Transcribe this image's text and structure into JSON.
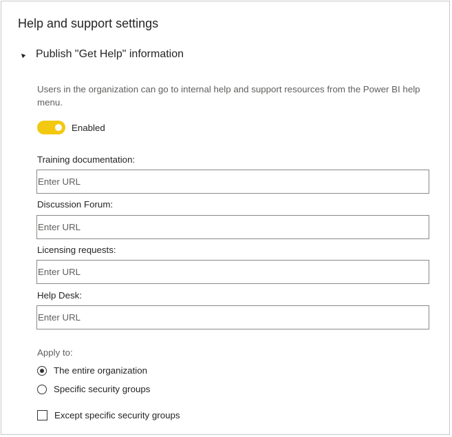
{
  "page": {
    "title": "Help and support settings"
  },
  "section": {
    "title": "Publish \"Get Help\" information",
    "icon": "caret-expanded-icon",
    "description": "Users in the organization can go to internal help and support resources from the Power BI help menu."
  },
  "toggle": {
    "label": "Enabled",
    "state": "on",
    "color": "#f2c811"
  },
  "fields": [
    {
      "label": "Training documentation:",
      "value": "",
      "placeholder": "Enter URL"
    },
    {
      "label": "Discussion Forum:",
      "value": "",
      "placeholder": "Enter URL"
    },
    {
      "label": "Licensing requests:",
      "value": "",
      "placeholder": "Enter URL"
    },
    {
      "label": "Help Desk:",
      "value": "",
      "placeholder": "Enter URL"
    }
  ],
  "apply_to": {
    "label": "Apply to:",
    "options": [
      {
        "label": "The entire organization",
        "selected": true
      },
      {
        "label": "Specific security groups",
        "selected": false
      }
    ]
  },
  "except": {
    "label": "Except specific security groups",
    "checked": false
  }
}
